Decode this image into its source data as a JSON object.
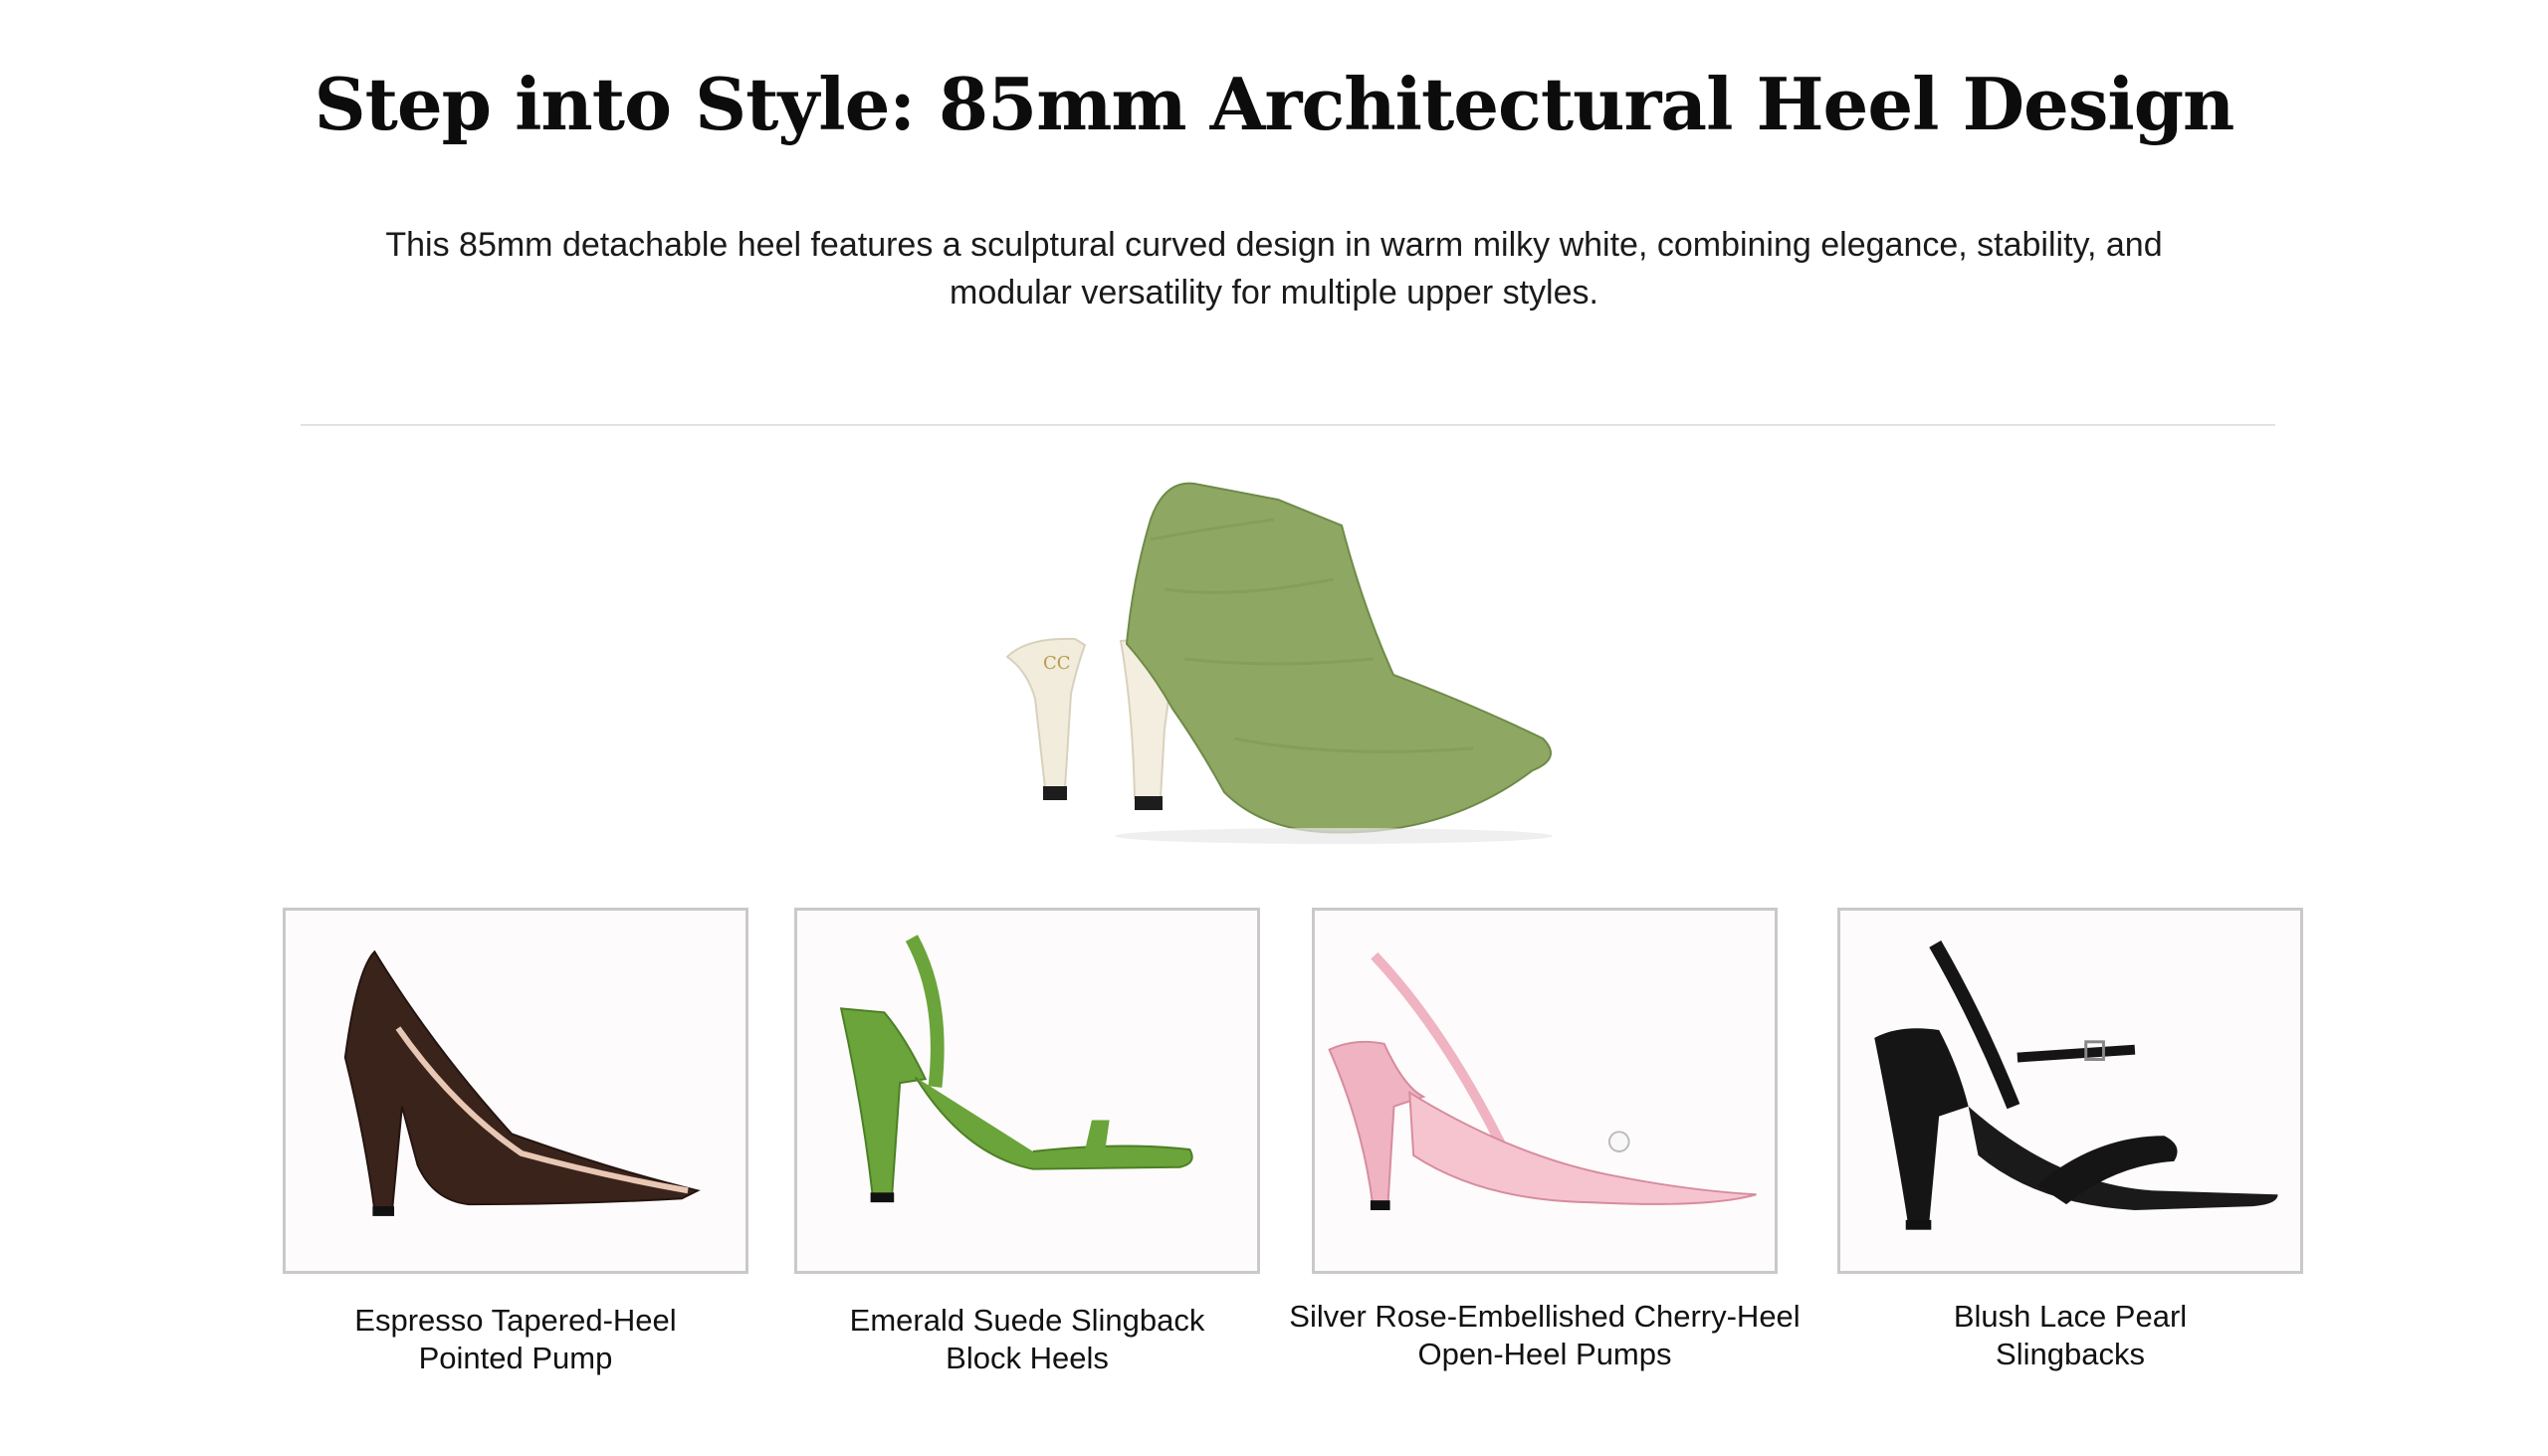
{
  "page": {
    "title": "Step into Style: 85mm Architectural Heel Design",
    "description": "This 85mm detachable heel features a sculptural curved design in warm milky white, combining elegance, stability, and modular versatility for multiple upper styles."
  },
  "hero": {
    "icon": "green-bootie-with-detachable-heel-icon"
  },
  "products": [
    {
      "line1": "Espresso Tapered-Heel",
      "line2": "Pointed Pump",
      "color": "#3a231b"
    },
    {
      "line1": "Emerald Suede Slingback",
      "line2": "Block Heels",
      "color": "#6aa43a"
    },
    {
      "line1": "Silver Rose-Embellished Cherry-Heel",
      "line2": "Open-Heel Pumps",
      "color": "#f0b3c1"
    },
    {
      "line1": "Blush Lace Pearl",
      "line2": "Slingbacks",
      "color": "#151515"
    }
  ]
}
